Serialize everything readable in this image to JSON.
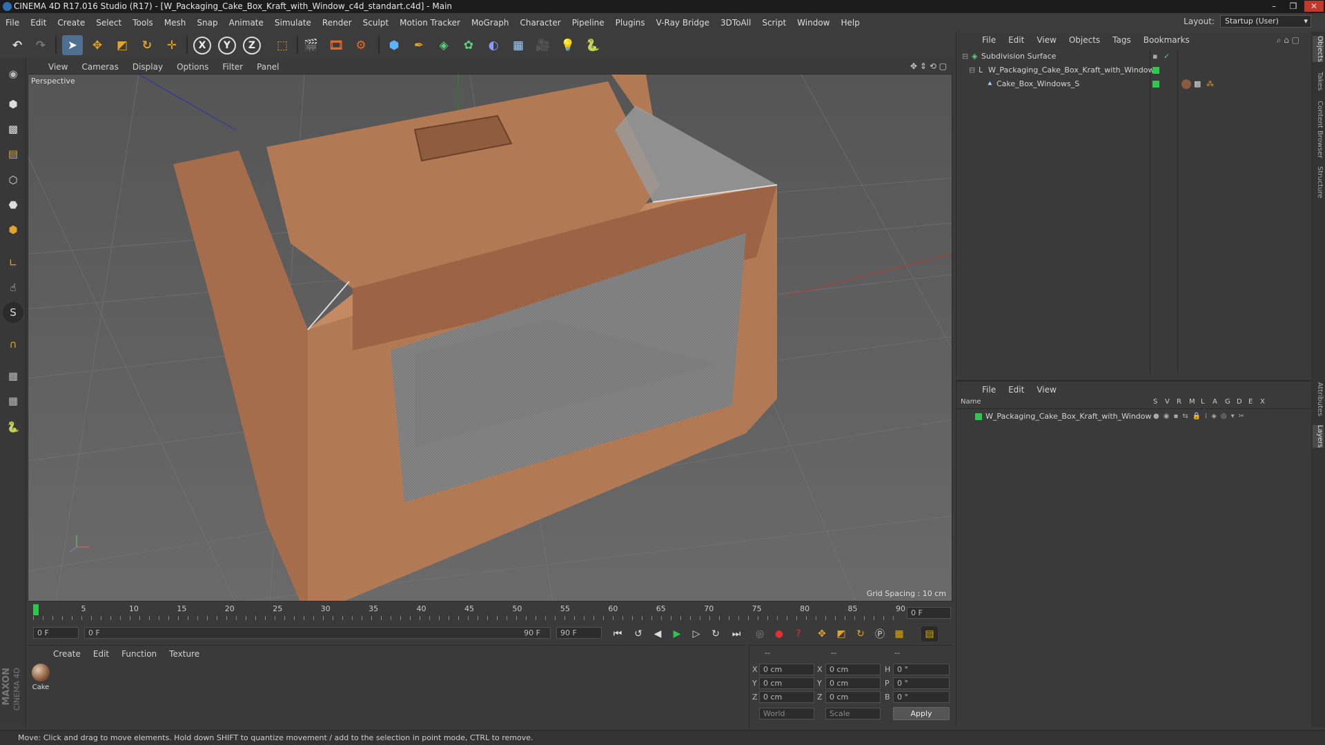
{
  "window": {
    "title": "CINEMA 4D R17.016 Studio (R17) - [W_Packaging_Cake_Box_Kraft_with_Window_c4d_standart.c4d] - Main",
    "controls": [
      "–",
      "❐",
      "✕"
    ]
  },
  "menubar": {
    "items": [
      "File",
      "Edit",
      "Create",
      "Select",
      "Tools",
      "Mesh",
      "Snap",
      "Animate",
      "Simulate",
      "Render",
      "Sculpt",
      "Motion Tracker",
      "MoGraph",
      "Character",
      "Pipeline",
      "Plugins",
      "V-Ray Bridge",
      "3DToAll",
      "Script",
      "Window",
      "Help"
    ],
    "layout_label": "Layout:",
    "layout_value": "Startup (User)"
  },
  "toolbar": {
    "icons": [
      "undo-icon",
      "redo-icon",
      "select-pointer-icon",
      "move-icon",
      "scale-icon",
      "rotate-icon",
      "live-select-icon",
      "lock-x-icon",
      "lock-y-icon",
      "lock-z-icon",
      "coordinate-system-icon",
      "render-view-icon",
      "render-picture-viewer-icon",
      "render-settings-icon",
      "cube-icon",
      "pen-spline-icon",
      "subdivision-icon",
      "mograph-cloner-icon",
      "deformer-icon",
      "floor-icon",
      "camera-icon",
      "light-icon",
      "python-icon"
    ],
    "axis_labels": [
      "X",
      "Y",
      "Z"
    ]
  },
  "left_tools": [
    "make-editable-icon",
    "model-mode-icon",
    "texture-mode-icon",
    "workplane-icon",
    "points-mode-icon",
    "edges-mode-icon",
    "polygons-mode-icon",
    "axis-mode-icon",
    "tweak-icon",
    "snap-icon",
    "magnet-icon",
    "grid-snap-icon",
    "workplane-lock-icon",
    "python-script-icon"
  ],
  "brand": {
    "line1": "MAXON",
    "line2": "CINEMA 4D"
  },
  "viewport": {
    "menu": [
      "View",
      "Cameras",
      "Display",
      "Options",
      "Filter",
      "Panel"
    ],
    "label": "Perspective",
    "grid_spacing": "Grid Spacing : 10 cm",
    "colors": {
      "background": "#5f5f5f",
      "kraft": "#b27a54",
      "kraft_dark": "#8e5c3e",
      "kraft_light": "#c48b63"
    }
  },
  "timeline": {
    "ticks": [
      "0",
      "5",
      "10",
      "15",
      "20",
      "25",
      "30",
      "35",
      "40",
      "45",
      "50",
      "55",
      "60",
      "65",
      "70",
      "75",
      "80",
      "85",
      "90"
    ],
    "current_frame": "0 F"
  },
  "transport": {
    "start_field": "0 F",
    "range_start": "0 F",
    "range_end": "90 F",
    "end_field": "90 F"
  },
  "material_panel": {
    "menu": [
      "Create",
      "Edit",
      "Function",
      "Texture"
    ],
    "materials": [
      {
        "name": "Cake"
      }
    ]
  },
  "coord_panel": {
    "headers": [
      "--",
      "--",
      "--"
    ],
    "rows": [
      {
        "a_label": "X",
        "a_val": "0 cm",
        "b_label": "X",
        "b_val": "0 cm",
        "c_label": "H",
        "c_val": "0 °"
      },
      {
        "a_label": "Y",
        "a_val": "0 cm",
        "b_label": "Y",
        "b_val": "0 cm",
        "c_label": "P",
        "c_val": "0 °"
      },
      {
        "a_label": "Z",
        "a_val": "0 cm",
        "b_label": "Z",
        "b_val": "0 cm",
        "c_label": "B",
        "c_val": "0 °"
      }
    ],
    "space_select": "World",
    "mode_select": "Scale",
    "apply_label": "Apply"
  },
  "object_manager": {
    "menu": [
      "File",
      "Edit",
      "View",
      "Objects",
      "Tags",
      "Bookmarks"
    ],
    "objects": [
      {
        "name": "Subdivision Surface"
      },
      {
        "name": "W_Packaging_Cake_Box_Kraft_with_Window"
      },
      {
        "name": "Cake_Box_Windows_S"
      }
    ]
  },
  "layer_manager": {
    "menu": [
      "File",
      "Edit",
      "View"
    ],
    "col_name": "Name",
    "col_flags": [
      "S",
      "V",
      "R",
      "M",
      "L",
      "A",
      "G",
      "D",
      "E",
      "X"
    ],
    "layers": [
      {
        "name": "W_Packaging_Cake_Box_Kraft_with_Window"
      }
    ]
  },
  "right_tabs": [
    "Objects",
    "Takes",
    "Content Browser",
    "Structure",
    "Attributes",
    "Layers"
  ],
  "status": "Move: Click and drag to move elements. Hold down SHIFT to quantize movement / add to the selection in point mode, CTRL to remove."
}
